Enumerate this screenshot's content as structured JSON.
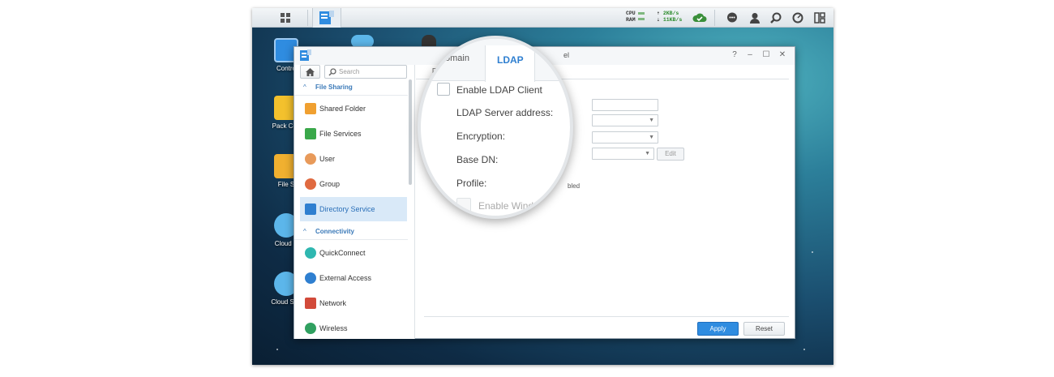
{
  "taskbar": {
    "stats": {
      "cpu_label": "CPU",
      "ram_label": "RAM",
      "up": "2KB/s",
      "down": "11KB/s"
    },
    "tray_icons": [
      "cloud-check-icon",
      "chat-icon",
      "user-icon",
      "search-icon",
      "gauge-icon",
      "widgets-icon"
    ]
  },
  "desktop": {
    "icons": [
      {
        "label": "Contro"
      },
      {
        "label": "Pack Cen"
      },
      {
        "label": "File S"
      },
      {
        "label": "Cloud S"
      },
      {
        "label": "Cloud Stat"
      }
    ]
  },
  "window": {
    "controls": [
      "?",
      "–",
      "☐",
      "✕"
    ],
    "search_placeholder": "Search",
    "sections": [
      {
        "title": "File Sharing"
      },
      {
        "title": "Connectivity"
      }
    ],
    "items": [
      {
        "label": "Shared Folder",
        "color": "#f0a030"
      },
      {
        "label": "File Services",
        "color": "#3aa84a"
      },
      {
        "label": "User",
        "color": "#e89a5a"
      },
      {
        "label": "Group",
        "color": "#e06a40"
      },
      {
        "label": "Directory Service",
        "color": "#2f7fd0"
      },
      {
        "label": "QuickConnect",
        "color": "#2fb7b0"
      },
      {
        "label": "External Access",
        "color": "#2f7fd0"
      },
      {
        "label": "Network",
        "color": "#d24a3a"
      },
      {
        "label": "Wireless",
        "color": "#30a060"
      }
    ],
    "tabs": {
      "domain_partial": "omain",
      "ldap": "LDAP",
      "other_partial": "el"
    },
    "under_tab_partial": "D",
    "enabled_partial": "bled",
    "edit_label": "Edit",
    "apply_label": "Apply",
    "reset_label": "Reset"
  },
  "magnifier": {
    "enable_ldap": "Enable LDAP Client",
    "server_address": "LDAP Server address:",
    "encryption": "Encryption:",
    "base_dn": "Base DN:",
    "profile": "Profile:",
    "enable_windows_partial": "Enable Window"
  },
  "colors": {
    "accent": "#2f8ce0",
    "selected_bg": "#d9e9f8"
  }
}
